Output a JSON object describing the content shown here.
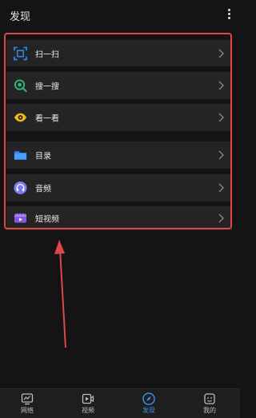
{
  "header": {
    "title": "发现",
    "more_icon": "more-vertical-icon"
  },
  "list": {
    "items": [
      {
        "label": "扫一扫",
        "icon": "scan-icon",
        "icon_color": "#2f86f6"
      },
      {
        "label": "搜一搜",
        "icon": "search-icon",
        "icon_color": "#2fb87a"
      },
      {
        "label": "看一看",
        "icon": "eye-icon",
        "icon_color": "#f2b824"
      },
      {
        "label": "目录",
        "icon": "folder-icon",
        "icon_color": "#2f86f6"
      },
      {
        "label": "音频",
        "icon": "headphones-icon",
        "icon_color": "#7d7bf0"
      },
      {
        "label": "短视频",
        "icon": "short-video-icon",
        "icon_color": "#8a58e0"
      }
    ],
    "highlight_color": "#e04848"
  },
  "tabs": [
    {
      "label": "网络",
      "icon": "network-icon",
      "active": false
    },
    {
      "label": "视频",
      "icon": "video-icon",
      "active": false
    },
    {
      "label": "发现",
      "icon": "compass-icon",
      "active": true
    },
    {
      "label": "我的",
      "icon": "profile-icon",
      "active": false
    }
  ],
  "colors": {
    "accent": "#3b8ff5",
    "annotation": "#e04848",
    "background": "#141414"
  }
}
